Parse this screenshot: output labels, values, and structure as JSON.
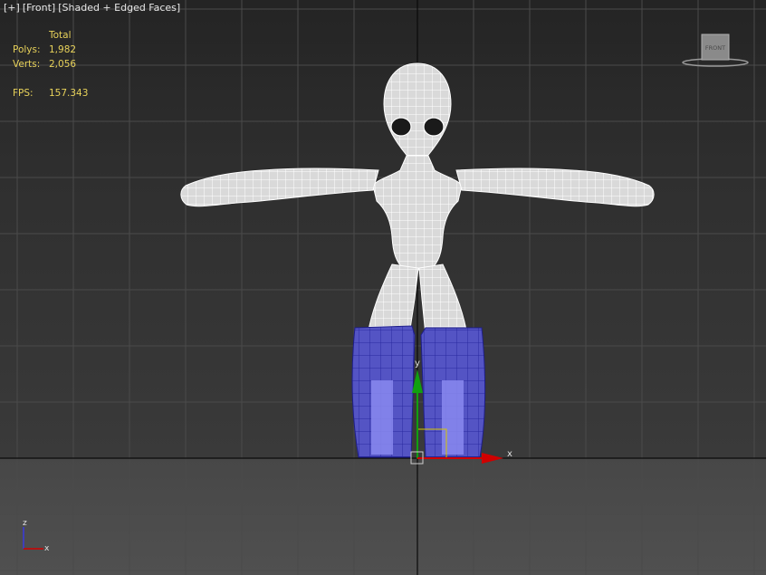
{
  "viewport": {
    "menu": {
      "plus": "[+]",
      "view": "[Front]",
      "shading": "[Shaded + Edged Faces]"
    },
    "stats": {
      "header": "Total",
      "polys_label": "Polys:",
      "polys_value": "1,982",
      "verts_label": "Verts:",
      "verts_value": "2,056",
      "fps_label": "FPS:",
      "fps_value": "157.343"
    },
    "viewcube_label": "FRONT",
    "gizmo": {
      "x_label": "x",
      "y_label": "y"
    },
    "tripod": {
      "x_label": "x",
      "z_label": "z"
    },
    "colors": {
      "stats": "#e8d25a",
      "selection": "#4a4ab8",
      "mesh": "#efefef",
      "gizmo_x": "#d00000",
      "gizmo_y": "#10a010"
    }
  }
}
